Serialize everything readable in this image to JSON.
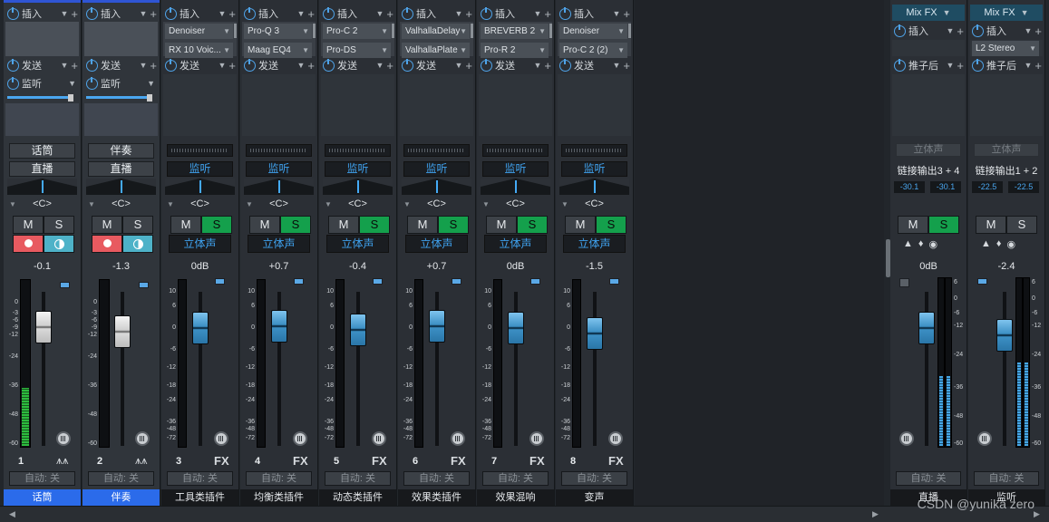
{
  "section_labels": {
    "insert": "插入",
    "send": "发送",
    "monitor_send": "监听",
    "post_fader": "推子后"
  },
  "channels": [
    {
      "index": "1",
      "name": "话筒",
      "tag1": "话筒",
      "tag2": "直播",
      "pan": "<C>",
      "mute": "M",
      "solo": "S",
      "volume": "-0.1",
      "auto": "自动: 关",
      "selected": true,
      "type": "audio",
      "plugins": []
    },
    {
      "index": "2",
      "name": "伴奏",
      "tag1": "伴奏",
      "tag2": "直播",
      "pan": "<C>",
      "mute": "M",
      "solo": "S",
      "volume": "-1.3",
      "auto": "自动: 关",
      "selected": true,
      "type": "audio",
      "plugins": []
    },
    {
      "index": "3",
      "name": "工具类插件",
      "monitor": "监听",
      "pan": "<C>",
      "mute": "M",
      "solo": "S",
      "stereo": "立体声",
      "volume": "0dB",
      "fx": "FX",
      "auto": "自动: 关",
      "type": "fx",
      "plugins": [
        "Denoiser",
        "RX 10 Voic..."
      ]
    },
    {
      "index": "4",
      "name": "均衡类插件",
      "monitor": "监听",
      "pan": "<C>",
      "mute": "M",
      "solo": "S",
      "stereo": "立体声",
      "volume": "+0.7",
      "fx": "FX",
      "auto": "自动: 关",
      "type": "fx",
      "plugins": [
        "Pro-Q 3",
        "Maag EQ4"
      ]
    },
    {
      "index": "5",
      "name": "动态类插件",
      "monitor": "监听",
      "pan": "<C>",
      "mute": "M",
      "solo": "S",
      "stereo": "立体声",
      "volume": "-0.4",
      "fx": "FX",
      "auto": "自动: 关",
      "type": "fx",
      "plugins": [
        "Pro-C 2",
        "Pro-DS"
      ]
    },
    {
      "index": "6",
      "name": "效果类插件",
      "monitor": "监听",
      "pan": "<C>",
      "mute": "M",
      "solo": "S",
      "stereo": "立体声",
      "volume": "+0.7",
      "fx": "FX",
      "auto": "自动: 关",
      "type": "fx",
      "plugins": [
        "ValhallaDelay",
        "ValhallaPlate"
      ]
    },
    {
      "index": "7",
      "name": "效果混响",
      "monitor": "监听",
      "pan": "<C>",
      "mute": "M",
      "solo": "S",
      "stereo": "立体声",
      "volume": "0dB",
      "fx": "FX",
      "auto": "自动: 关",
      "type": "fx",
      "plugins": [
        "BREVERB 2",
        "Pro-R 2"
      ]
    },
    {
      "index": "8",
      "name": "变声",
      "monitor": "监听",
      "pan": "<C>",
      "mute": "M",
      "solo": "S",
      "stereo": "立体声",
      "volume": "-1.5",
      "fx": "FX",
      "auto": "自动: 关",
      "type": "fx",
      "plugins": [
        "Denoiser",
        "Pro-C 2 (2)"
      ]
    }
  ],
  "outputs": [
    {
      "mixfx": "Mix FX",
      "plugin": "",
      "disabled": "立体声",
      "link": "链接输出3 + 4",
      "db_l": "-30.1",
      "db_r": "-30.1",
      "mute": "M",
      "solo": "S",
      "volume": "0dB",
      "auto": "自动: 关",
      "name": "直播",
      "solo_on": true,
      "level": 0.42
    },
    {
      "mixfx": "Mix FX",
      "plugin": "L2 Stereo",
      "disabled": "立体声",
      "link": "链接输出1 + 2",
      "db_l": "-22.5",
      "db_r": "-22.5",
      "mute": "M",
      "solo": "S",
      "volume": "-2.4",
      "auto": "自动: 关",
      "name": "监听",
      "solo_on": false,
      "level": 0.5
    }
  ],
  "audio_meter_levels": [
    0.35,
    0.0
  ],
  "watermark": "CSDN @yunika zero",
  "colors": {
    "accent_blue": "#3fa2ef",
    "solo_green": "#14a04c",
    "record_red": "#e85a60",
    "selection_blue": "#2b6bea"
  }
}
